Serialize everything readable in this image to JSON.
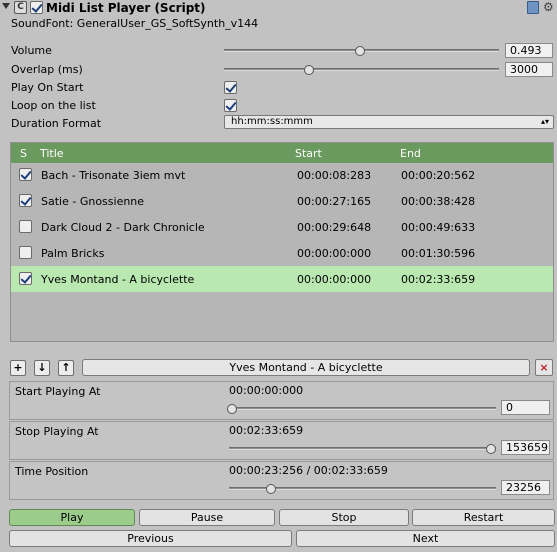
{
  "header": {
    "title": "Midi List Player (Script)",
    "enabled": true,
    "soundfont_label": "SoundFont: GeneralUser_GS_SoftSynth_v144"
  },
  "settings": {
    "volume_label": "Volume",
    "volume_value": "0.493",
    "volume_level": 0.493,
    "overlap_label": "Overlap (ms)",
    "overlap_value": "3000",
    "overlap_level": 0.3,
    "play_on_start_label": "Play On Start",
    "play_on_start": true,
    "loop_label": "Loop on the list",
    "loop": true,
    "duration_format_label": "Duration Format",
    "duration_format_value": "hh:mm:ss:mmm"
  },
  "list": {
    "columns": [
      "S",
      "Title",
      "Start",
      "End"
    ],
    "rows": [
      {
        "checked": true,
        "title": "Bach - Trisonate 3iem mvt",
        "start": "00:00:08:283",
        "end": "00:00:20:562",
        "selected": false
      },
      {
        "checked": true,
        "title": "Satie - Gnossienne",
        "start": "00:00:27:165",
        "end": "00:00:38:428",
        "selected": false
      },
      {
        "checked": false,
        "title": "Dark Cloud 2 - Dark Chronicle",
        "start": "00:00:29:648",
        "end": "00:00:49:633",
        "selected": false
      },
      {
        "checked": false,
        "title": "Palm Bricks",
        "start": "00:00:00:000",
        "end": "00:01:30:596",
        "selected": false
      },
      {
        "checked": true,
        "title": "Yves Montand - A bicyclette",
        "start": "00:00:00:000",
        "end": "00:02:33:659",
        "selected": true
      }
    ]
  },
  "toolbar": {
    "add_glyph": "+",
    "down_glyph": "↓",
    "up_glyph": "↑",
    "selected_title": "Yves Montand - A bicyclette",
    "remove_glyph": "×"
  },
  "start_panel": {
    "label": "Start Playing At",
    "time": "00:00:00:000",
    "value": "0",
    "level": 0.0
  },
  "stop_panel": {
    "label": "Stop Playing At",
    "time": "00:02:33:659",
    "value": "153659",
    "level": 1.0
  },
  "position_panel": {
    "label": "Time Position",
    "time": "00:00:23:256 / 00:02:33:659",
    "value": "23256",
    "level": 0.151
  },
  "controls": {
    "play": "Play",
    "pause": "Pause",
    "stop": "Stop",
    "restart": "Restart",
    "previous": "Previous",
    "next": "Next"
  }
}
